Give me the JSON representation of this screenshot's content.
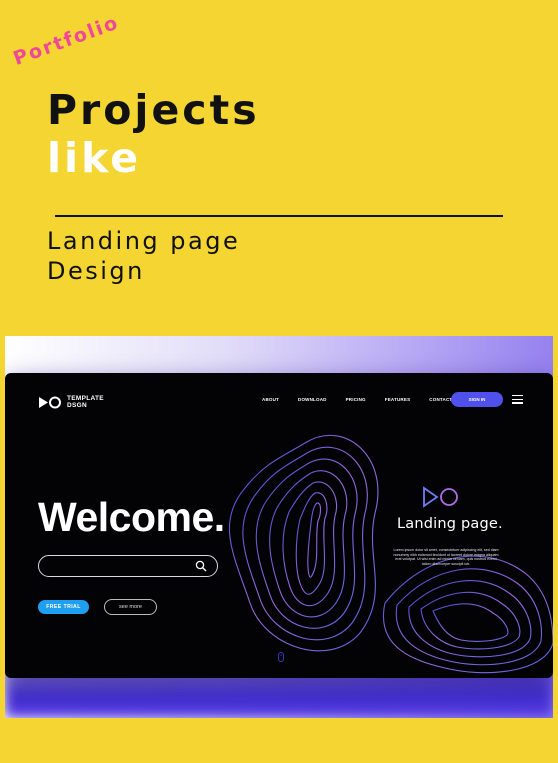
{
  "header": {
    "tag": "Portfolio",
    "title_line1": "Projects",
    "title_line2": "like",
    "subtitle_line1": "Landing page",
    "subtitle_line2": "Design"
  },
  "site": {
    "logo_text": "TEMPLATE DSGN",
    "nav": [
      "ABOUT",
      "DOWNLOAD",
      "PRICING",
      "FEATURES",
      "CONTACT"
    ],
    "signin": "SIGN IN",
    "welcome": "Welcome.",
    "free_trial": "FREE TRIAL",
    "see_more": "see more",
    "landing_title": "Landing page.",
    "lorem": "Lorem ipsum dolor sit amet, consectetuer adipiscing elit, sed diam nonummy nibh euismod tincidunt ut laoreet dolore magna aliquam erat volutpat. Ut wisi enim ad minim veniam, quis nostrud exerci tation ullamcorper suscipit lob."
  },
  "colors": {
    "background": "#f4d532",
    "accent_pink": "#f0479b",
    "signin_blue": "#5050ec",
    "free_trial_blue": "#1f9ff0"
  }
}
